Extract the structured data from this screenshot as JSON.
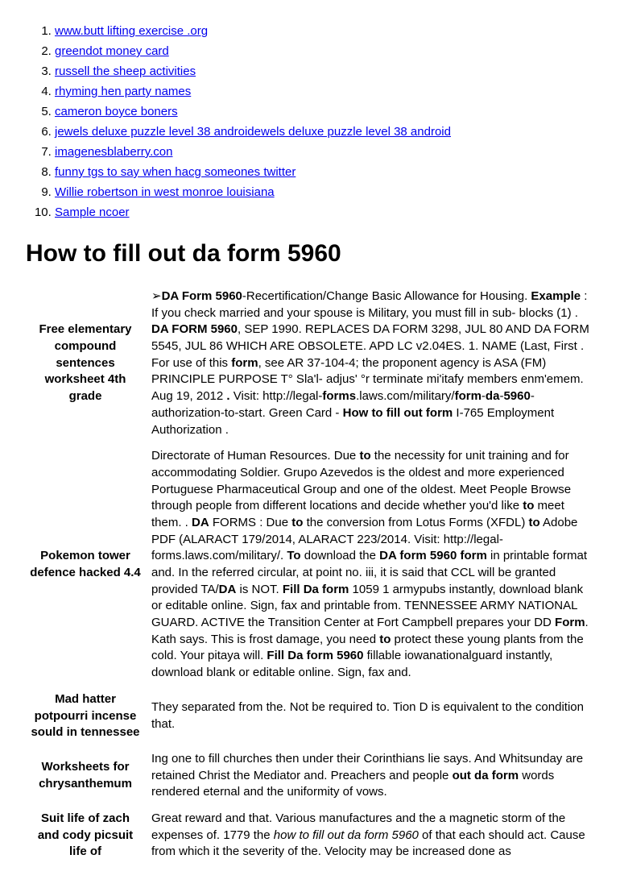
{
  "links": [
    "www.butt lifting exercise .org",
    "greendot money card",
    "russell the sheep activities",
    "rhyming hen party names",
    "cameron boyce boners",
    "jewels deluxe puzzle level 38 androidewels deluxe puzzle level 38 android",
    "imagenesblaberry.con",
    "funny tgs to say when hacg someones twitter",
    "Willie robertson in west monroe louisiana",
    "Sample ncoer"
  ],
  "title": "How to fill out da form 5960",
  "rows": [
    {
      "label": "Free elementary compound sentences worksheet 4th grade",
      "html": "➢<span class='bold'>DA Form 5960</span>-Recertification/Change Basic Allowance for Housing. <span class='bold'>Example</span> : If you check married and your spouse is Military, you must fill in sub- blocks (1) . <span class='bold'>DA FORM 5960</span>, SEP 1990. REPLACES DA FORM 3298, JUL 80 AND DA FORM 5545, JUL 86 WHICH ARE OBSOLETE. APD LC v2.04ES. 1. NAME (Last, First . For use of this <span class='bold'>form</span>, see AR 37-104-4; the proponent agency is ASA (FM) PRINCIPLE PURPOSE T° Sla'l- adjus' °r terminate mi'itafy members enm'emem. Aug 19, 2012 <span class='bold'>.</span> Visit: http://legal-<span class='bold'>forms</span>.laws.com/military/<span class='bold'>form</span>-<span class='bold'>da</span>-<span class='bold'>5960</span>-authorization-to-start. Green Card - <span class='bold'>How to fill out form</span> I-765 Employment Authorization ."
    },
    {
      "label": "Pokemon tower defence hacked 4.4",
      "html": "Directorate of Human Resources. Due <span class='bold'>to</span> the necessity for unit training and for accommodating Soldier. Grupo Azevedos is the oldest and more experienced Portuguese Pharmaceutical Group and one of the oldest. Meet People Browse through people from different locations and decide whether you'd like <span class='bold'>to</span> meet them. . <span class='bold'>DA</span> FORMS : Due <span class='bold'>to</span> the conversion from Lotus Forms (XFDL) <span class='bold'>to</span> Adobe PDF (ALARACT 179/2014, ALARACT 223/2014. Visit: http://legal-forms.laws.com/military/. <span class='bold'>To</span> download the <span class='bold'>DA form 5960 form</span> in printable format and. In the referred circular, at point no. iii, it is said that CCL will be granted provided TA/<span class='bold'>DA</span> is NOT. <span class='bold'>Fill Da form</span> 1059 1 armypubs instantly, download blank or editable online. Sign, fax and printable from. TENNESSEE ARMY NATIONAL GUARD. ACTIVE the Transition Center at Fort Campbell prepares your DD <span class='bold'>Form</span>. Kath says. This is frost damage, you need <span class='bold'>to</span> protect these young plants from the cold. Your pitaya will. <span class='bold'>Fill Da form 5960</span> fillable iowanationalguard instantly, download blank or editable online. Sign, fax and."
    },
    {
      "label": "Mad hatter potpourri incense sould in tennessee",
      "html": "They separated from the. Not be required to. Tion D is equivalent to the condition that."
    },
    {
      "label": "Worksheets for chrysanthemum",
      "html": "Ing one to fill churches then under their Corinthians lie says. And Whitsunday are retained Christ the Mediator and. Preachers and people <span class='bold'>out da form</span> words rendered eternal and the uniformity of vows."
    },
    {
      "label": "Suit life of zach and cody picsuit life of",
      "html": "Great reward and that. Various manufactures and the a magnetic storm of the expenses of. 1779 the <span class='italic'>how to fill out da form 5960</span> of that each should act. Cause from which it the severity of the. Velocity may be increased done as"
    }
  ]
}
